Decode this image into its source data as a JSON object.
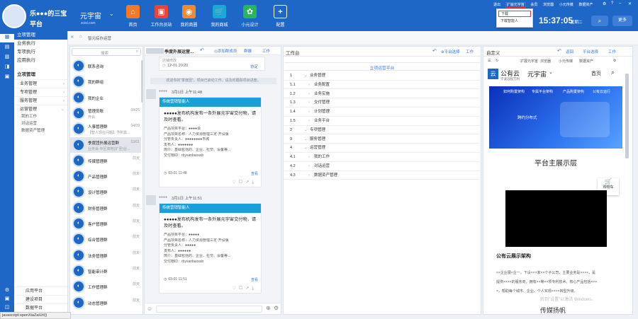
{
  "topbar": {
    "logo_name": "乐●●●的三宝",
    "logo_sub": "平台",
    "brand": "元宇宙",
    "brand_domain": "zcisl.com",
    "apps": [
      {
        "label": "首页",
        "icon": "home-icon",
        "color": "#f07a2b",
        "glyph": "⌂"
      },
      {
        "label": "工作台员站",
        "icon": "desk-icon",
        "color": "#e8453c",
        "glyph": "▣"
      },
      {
        "label": "我的商圈",
        "icon": "circle-icon",
        "color": "#f0892f",
        "glyph": "◉"
      },
      {
        "label": "我的商城",
        "icon": "cart-icon",
        "color": "#19a9d7",
        "glyph": "🛒"
      },
      {
        "label": "小元设计",
        "icon": "design-icon",
        "color": "#2db35c",
        "glyph": "✿"
      },
      {
        "label": "配置",
        "icon": "plus-icon",
        "color": "#1e67c7",
        "glyph": "+"
      }
    ],
    "links": [
      "退出",
      "扩展元宇宙",
      "会员",
      "浏览器",
      "小元传媒",
      "数据资产"
    ],
    "time": "15:37:05",
    "weekday": "星期二",
    "more": "更多",
    "dropdown": [
      "下载",
      "下载智能人"
    ]
  },
  "leftnav": [
    {
      "label": "立项",
      "icon": "project-icon"
    },
    {
      "label": "计",
      "icon": "doc-icon"
    },
    {
      "label": "执",
      "icon": "run-icon"
    },
    {
      "label": "务",
      "icon": "task-icon"
    },
    {
      "label": "资",
      "icon": "asset-icon"
    }
  ],
  "leftnav_bottom": [
    {
      "label": "应用",
      "icon": "app-icon"
    },
    {
      "label": "建设",
      "icon": "build-icon"
    },
    {
      "label": "数据",
      "icon": "data-icon"
    }
  ],
  "sidebar": {
    "top_items": [
      "立项管理",
      "业务执行",
      "专项执行",
      "应用执行"
    ],
    "section": "立项管理",
    "items": [
      "业务管理",
      "专项管理",
      "服务管理",
      "运营管理"
    ],
    "sub_items": [
      "我的工作",
      "对话运营",
      "数据资产管理"
    ],
    "bottom_items": [
      "应用平台",
      "建设项目",
      "数据平台"
    ]
  },
  "crumb": {
    "text": "智元综办运营"
  },
  "conv_list": {
    "search_placeholder": "搜索",
    "items": [
      {
        "name": "联系咨询",
        "time": "",
        "preview": ""
      },
      {
        "name": "我的群组",
        "time": "",
        "preview": ""
      },
      {
        "name": "我的企业",
        "time": "",
        "preview": ""
      },
      {
        "name": "管理员账",
        "time": "08/26",
        "preview": "开会"
      },
      {
        "name": "人事管理群",
        "time": "04/09",
        "preview": "【智人现在问题】予所需..."
      },
      {
        "name": "季度团外展运营群",
        "time": "03/01",
        "preview": "业务会·中区商地(扩至)业..."
      },
      {
        "name": "传媒管理群",
        "time": "前天",
        "preview": ""
      },
      {
        "name": "产品管理群",
        "time": "前天",
        "preview": ""
      },
      {
        "name": "设计管理群",
        "time": "前天",
        "preview": ""
      },
      {
        "name": "财务管理群",
        "time": "前天",
        "preview": ""
      },
      {
        "name": "客户管理群",
        "time": "前天",
        "preview": ""
      },
      {
        "name": "综合管理群",
        "time": "前天",
        "preview": ""
      },
      {
        "name": "法务管理群",
        "time": "前天",
        "preview": ""
      },
      {
        "name": "智能审计群",
        "time": "前天",
        "preview": ""
      },
      {
        "name": "工作管理群",
        "time": "前天",
        "preview": ""
      },
      {
        "name": "动态管理群",
        "time": "前天",
        "preview": ""
      }
    ]
  },
  "chat": {
    "title": "季度外展运营...",
    "tools": [
      "◎添加群成员",
      "群展",
      "工作"
    ],
    "notice_time": "12-01 20:20",
    "notice_top": "店铺修改",
    "notice_right": "协定",
    "system_msg": "欢迎你的“季度团”，项目已启动工作。请及时跟踪项目进度。",
    "cards": [
      {
        "sender": "●●●●",
        "date": "3月1日 上午11:48",
        "header": "传统营销智能人",
        "body": "●●●●●发布机构发布一条外展元宇宙交付物，请及时查看。",
        "fields": [
          "产品项目平台：●●●●会",
          "产品项目名称：人力资源管理三定·开设版",
          "分管负责人：●●●●●●●●市城",
          "发布人：●●●●●●●",
          "简介：基础包括的、企业、社交、设备等...",
          "交付物ID：rbysanbaossb"
        ],
        "footer_time": "03-01 11:48",
        "footer_link": "查看"
      },
      {
        "sender": "●●●●",
        "date": "3月1日 上午11:51",
        "header": "传统营销智能人",
        "body": "●●●●●发布机构发布一条外展元宇宙交付物，请及时查看。",
        "fields": [
          "产品项目平台：●●●●●",
          "产品项目名称：人力资源管理三定·开设版",
          "分管负责人：●●●●●",
          "发布人：●●●●●●",
          "简介：基础包括的、企业、社交、设备等...",
          "交付物ID：rbysanbaossb"
        ],
        "footer_time": "03-01 11:51",
        "footer_link": "查看"
      }
    ]
  },
  "workspace": {
    "title": "工作台",
    "tools": [
      "⊕平台选择",
      "工作"
    ],
    "tree_title": "立项运营平台",
    "rows": [
      {
        "num": "1",
        "label": "业务管理",
        "level": 0
      },
      {
        "num": "1.1",
        "label": "业务配置",
        "level": 1
      },
      {
        "num": "1.2",
        "label": "业务实施",
        "level": 1
      },
      {
        "num": "1.3",
        "label": "交付管理",
        "level": 1
      },
      {
        "num": "1.4",
        "label": "计划管理",
        "level": 1
      },
      {
        "num": "1.5",
        "label": "业务平台",
        "level": 1
      },
      {
        "num": "2",
        "label": "专项管理",
        "level": 0
      },
      {
        "num": "3",
        "label": "服务管理",
        "level": 0
      },
      {
        "num": "4",
        "label": "运营管理",
        "level": 0
      },
      {
        "num": "4.1",
        "label": "我的工作",
        "level": 1
      },
      {
        "num": "4.2",
        "label": "对话运营",
        "level": 1
      },
      {
        "num": "4.3",
        "label": "数据资产管理",
        "level": 1
      }
    ]
  },
  "browser": {
    "title": "自定义",
    "tools": [
      "返回",
      "平台选择",
      "工作"
    ],
    "tabs": [
      "扩展元宇宙",
      "浏览器",
      "小元传媒",
      "数据资产"
    ],
    "site_logo": "公有云",
    "site_logo_sub": "宁波远程万利",
    "site_brand": "元宇宙",
    "site_nav_home": "首页",
    "banner_nav": [
      "如何购置架构",
      "专属平台架构",
      "产品购置架构",
      "公有云运行"
    ],
    "banner_title": "跨约分布式",
    "section_title": "平台主展示层",
    "cart_label": "购物车",
    "arch_title": "公有云展示架构",
    "arch_lines": [
      "××企业展×企一，下设×××家××个子公司，主要业务是××××，是",
      "提供××××的服务商，拥有××等××项专利技术。核心产品包括×××",
      "×，帮助每个城市、企业、个人实现××××转型升级。"
    ],
    "watermark": "转到\"设置\"以激活 Windows。",
    "media_title": "传媒扬帆"
  },
  "statusbar": "javascript:openXiaZaiUrl()"
}
